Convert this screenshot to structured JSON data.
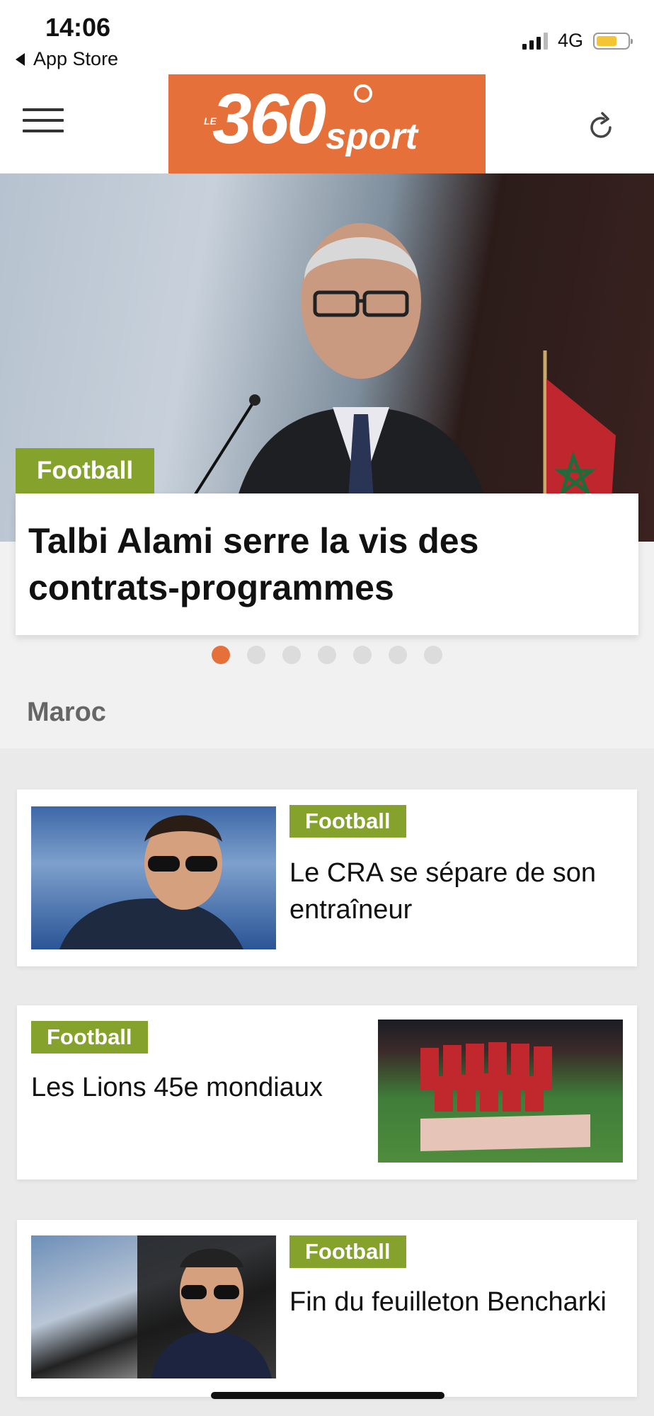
{
  "status_bar": {
    "time": "14:06",
    "back_label": "App Store",
    "network": "4G"
  },
  "header": {
    "logo_le": "LE",
    "logo_number": "360",
    "logo_sport": "sport"
  },
  "hero": {
    "tag": "Football",
    "title": "Talbi Alami serre la vis des contrats-programmes",
    "slide_count": 7,
    "active_slide": 1
  },
  "section": {
    "title": "Maroc"
  },
  "articles": [
    {
      "tag": "Football",
      "title": "Le CRA se sépare de son entraîneur"
    },
    {
      "tag": "Football",
      "title": "Les Lions 45e mondiaux"
    },
    {
      "tag": "Football",
      "title": "Fin du feuilleton Bencharki"
    }
  ],
  "colors": {
    "brand_orange": "#e5703a",
    "tag_green": "#84a22c"
  }
}
